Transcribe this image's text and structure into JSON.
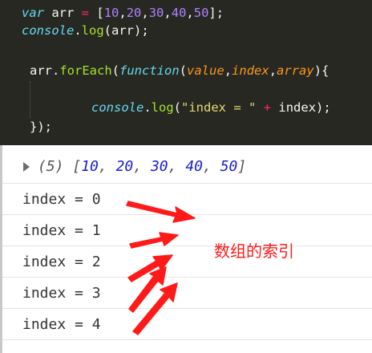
{
  "code": {
    "line1": {
      "kw": "var",
      "sp1": " arr ",
      "eq": "=",
      "open": " [",
      "n1": "10",
      "c1": ",",
      "n2": "20",
      "c2": ",",
      "n3": "30",
      "c3": ",",
      "n4": "40",
      "c4": ",",
      "n5": "50",
      "close": "];"
    },
    "line2": {
      "obj": "console",
      "dot": ".",
      "method": "log",
      "rest": "(arr);"
    },
    "line3": {
      "obj": "arr",
      "dot": ".",
      "method": "forEach",
      "open": "(",
      "kw": "function",
      "popen": "(",
      "p1": "value",
      "pc1": ",",
      "p2": "index",
      "pc2": ",",
      "p3": "array",
      "pclose": "){"
    },
    "line4": {
      "obj": "console",
      "dot": ".",
      "method": "log",
      "open": "(",
      "str": "\"index = \"",
      "sp": " ",
      "plus": "+",
      "rest": " index);"
    },
    "line5": {
      "text": "});"
    }
  },
  "console": {
    "summary": {
      "count": "(5) ",
      "open": "[",
      "values": [
        "10",
        "20",
        "30",
        "40",
        "50"
      ],
      "sep": ", ",
      "close": "]"
    },
    "logs": [
      "index = 0",
      "index = 1",
      "index = 2",
      "index = 3",
      "index = 4"
    ]
  },
  "annotation": {
    "label": "数组的索引",
    "color": "#ff1a1a"
  },
  "colors": {
    "editor_bg": "#272822",
    "keyword": "#66d9ef",
    "operator": "#f92672",
    "number": "#ae81ff",
    "function": "#a6e22e",
    "parameter": "#fd971f",
    "string": "#e6db74",
    "console_number": "#1c1ccc"
  }
}
